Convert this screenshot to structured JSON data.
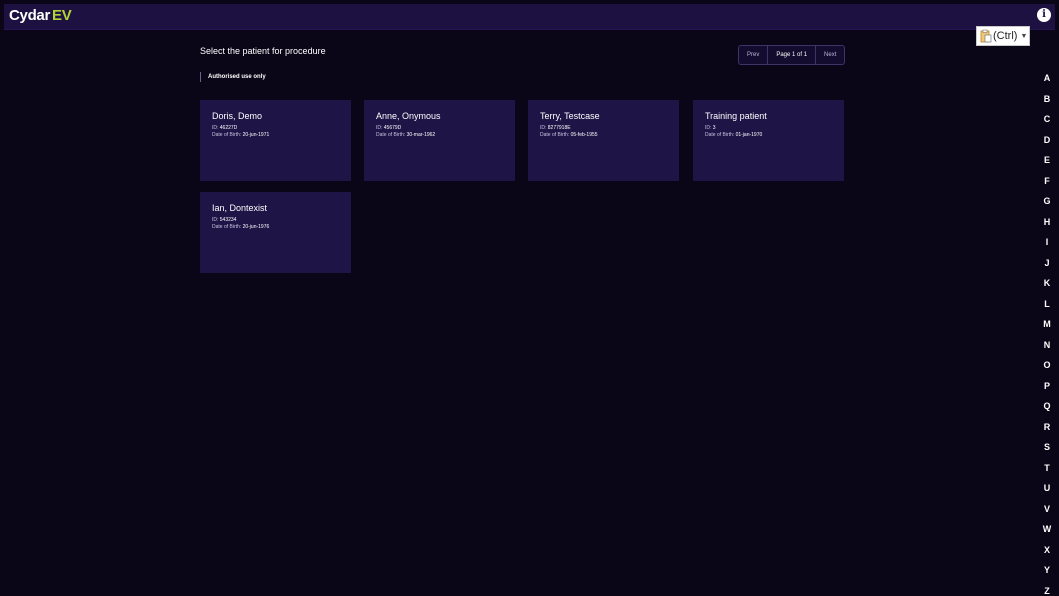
{
  "app": {
    "logo_main": "Cydar",
    "logo_accent": "EV",
    "info_icon": "i"
  },
  "clipboard": {
    "label": "(Ctrl)",
    "icon": "paste-icon",
    "caret": "▼"
  },
  "main": {
    "heading": "Select the patient for procedure",
    "auth_note": "Authorised use only"
  },
  "pager": {
    "prev": "Prev",
    "info": "Page 1 of 1",
    "next": "Next"
  },
  "patients": [
    {
      "name": "Doris, Demo",
      "id_label": "ID:",
      "id": "46227D",
      "dob_label": "Date of Birth:",
      "dob": "20-jun-1971"
    },
    {
      "name": "Anne, Onymous",
      "id_label": "ID:",
      "id": "45679D",
      "dob_label": "Date of Birth:",
      "dob": "30-mar-1962"
    },
    {
      "name": "Terry, Testcase",
      "id_label": "ID:",
      "id": "8277918E",
      "dob_label": "Date of Birth:",
      "dob": "05-feb-1955"
    },
    {
      "name": "Training patient",
      "id_label": "ID:",
      "id": "3",
      "dob_label": "Date of Birth:",
      "dob": "01-jan-1970"
    },
    {
      "name": "Ian, Dontexist",
      "id_label": "ID:",
      "id": "543234",
      "dob_label": "Date of Birth:",
      "dob": "20-jun-1976"
    }
  ],
  "alphabet": [
    "A",
    "B",
    "C",
    "D",
    "E",
    "F",
    "G",
    "H",
    "I",
    "J",
    "K",
    "L",
    "M",
    "N",
    "O",
    "P",
    "Q",
    "R",
    "S",
    "T",
    "U",
    "V",
    "W",
    "X",
    "Y",
    "Z"
  ],
  "colors": {
    "background": "#0a0617",
    "topbar": "#1c1140",
    "card": "#1e1446",
    "accent": "#b3d236"
  }
}
